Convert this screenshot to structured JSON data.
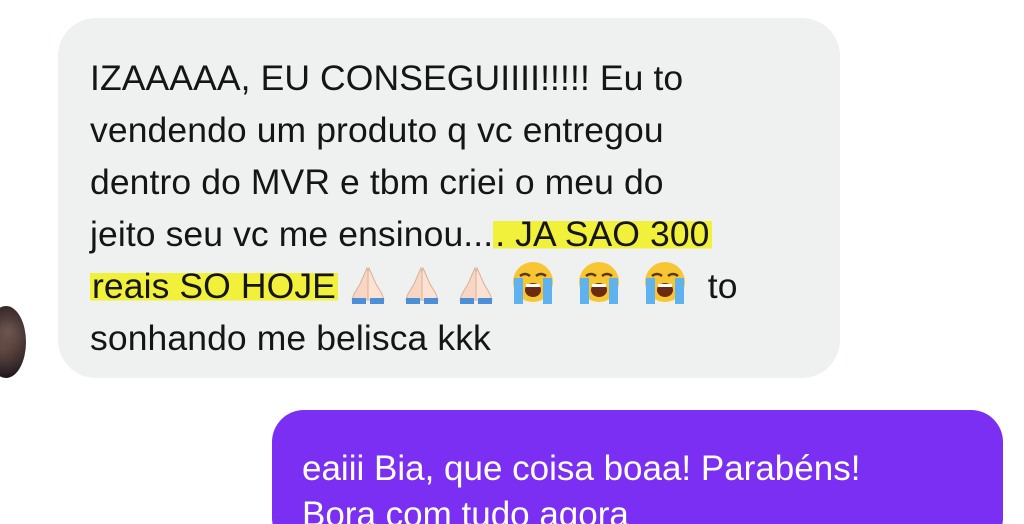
{
  "conversation": {
    "incoming": {
      "lines": [
        "IZAAAAA, EU CONSEGUIIII!!!!! Eu to",
        "vendendo um produto q vc entregou",
        "dentro do MVR e tbm criei o meu do",
        "jeito seu vc me ensinou"
      ],
      "line4_plain_end": "...",
      "highlight_part1": ". JA SAO 300",
      "highlight_part2": "reais SO HOJE",
      "after_emojis": "to",
      "last_line": "sonhando me belisca kkk",
      "emojis": [
        "folded-hands",
        "folded-hands",
        "folded-hands",
        "loudly-crying-face",
        "loudly-crying-face",
        "loudly-crying-face"
      ],
      "highlight_color": "#f1f03a",
      "bubble_color": "#eff1f1"
    },
    "outgoing": {
      "lines": [
        "eaiii Bia, que coisa boaa! Parabéns!",
        "Bora com tudo agora"
      ],
      "bubble_color": "#7a2ff2"
    }
  }
}
